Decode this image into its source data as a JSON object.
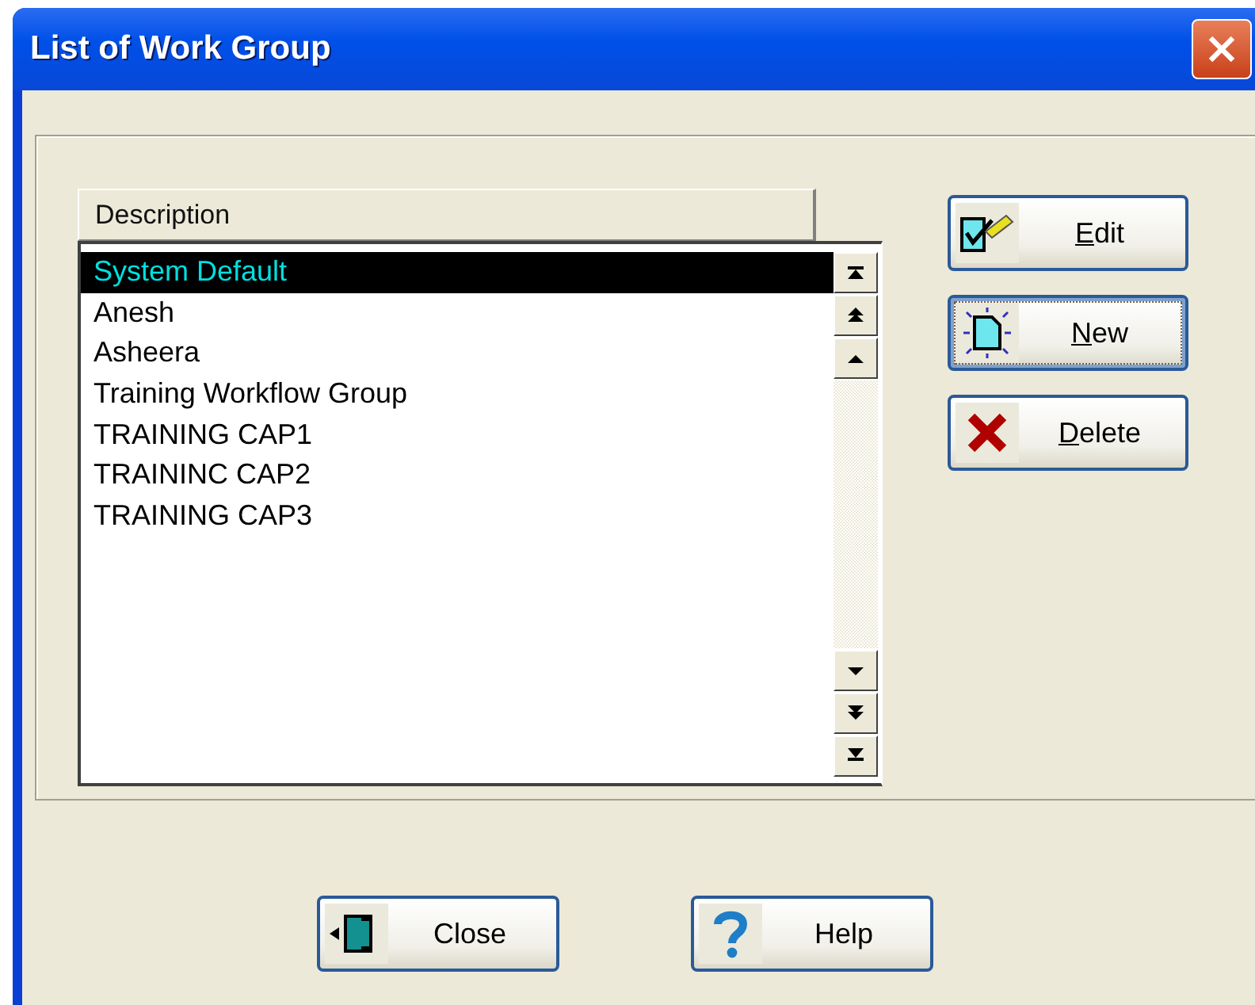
{
  "window": {
    "title": "List of Work Group"
  },
  "list": {
    "column": "Description",
    "rows": [
      {
        "text": "System Default",
        "selected": true
      },
      {
        "text": "Anesh",
        "selected": false
      },
      {
        "text": "Asheera",
        "selected": false
      },
      {
        "text": "Training Workflow Group",
        "selected": false
      },
      {
        "text": "TRAINING CAP1",
        "selected": false
      },
      {
        "text": "TRAININC CAP2",
        "selected": false
      },
      {
        "text": "TRAINING CAP3",
        "selected": false
      }
    ]
  },
  "side_buttons": [
    {
      "kind": "edit",
      "accel": "E",
      "rest": "dit",
      "focused": false
    },
    {
      "kind": "new",
      "accel": "N",
      "rest": "ew",
      "focused": true
    },
    {
      "kind": "delete",
      "accel": "D",
      "rest": "elete",
      "focused": false
    }
  ],
  "bottom_buttons": [
    {
      "kind": "close",
      "label": "Close"
    },
    {
      "kind": "help",
      "label": "Help"
    }
  ]
}
